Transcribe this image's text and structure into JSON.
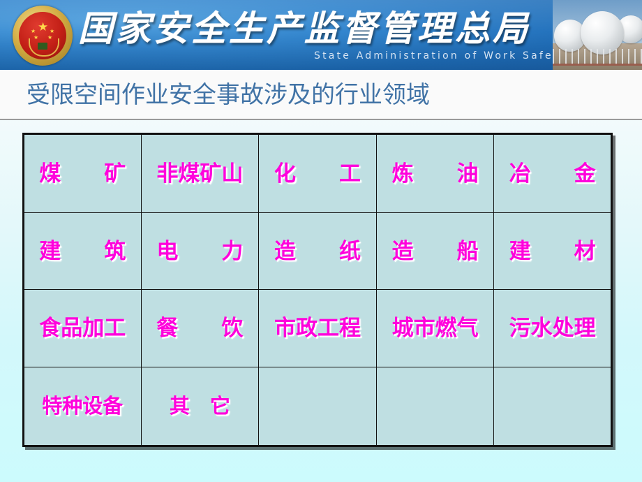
{
  "banner": {
    "emblem_name": "china-national-emblem",
    "agency_cn": "国家安全生产监督管理总局",
    "agency_en": "State Administration of Work Safety",
    "photo_name": "spherical-gas-storage-tanks-photo",
    "bg_color": "#2f83cd",
    "text_color": "#ffffff",
    "en_text_color": "#d5e3f2"
  },
  "slide": {
    "title": "受限空间作业安全事故涉及的行业领域",
    "title_color": "#4173a6",
    "background_color": "#ccfbfd",
    "divider_color": "#9a9a9a"
  },
  "table": {
    "cell_bg": "#bfdfe2",
    "border_color": "#111111",
    "text_color": "#ff00dc",
    "rows": [
      [
        "煤　　矿",
        "非煤矿山",
        "化　　工",
        "炼　　油",
        "冶　　金"
      ],
      [
        "建　　筑",
        "电　　力",
        "造　　纸",
        "造　　船",
        "建　　材"
      ],
      [
        "食品加工",
        "餐　　饮",
        "市政工程",
        "城市燃气",
        "污水处理"
      ],
      [
        "特种设备",
        "其　它",
        "",
        "",
        ""
      ]
    ]
  }
}
